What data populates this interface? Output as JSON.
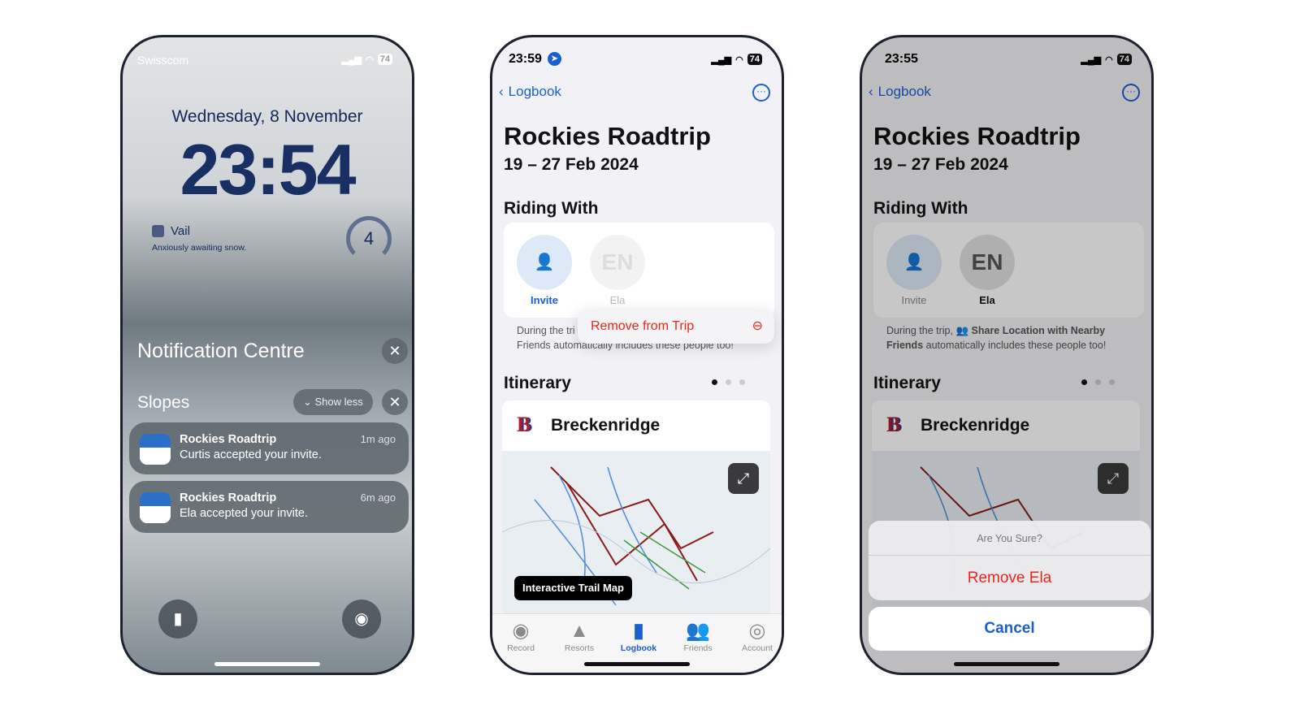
{
  "lock": {
    "carrier": "Swisscom",
    "battery": "74",
    "date": "Wednesday, 8 November",
    "time": "23:54",
    "widget": {
      "title": "Vail",
      "subtitle": "Anxiously awaiting snow.",
      "gauge_value": "4"
    },
    "notification_centre": "Notification Centre",
    "group": "Slopes",
    "show_less": "Show less",
    "notifications": [
      {
        "title": "Rockies Roadtrip",
        "body": "Curtis accepted your invite.",
        "time": "1m ago"
      },
      {
        "title": "Rockies Roadtrip",
        "body": "Ela accepted your invite.",
        "time": "6m ago"
      }
    ]
  },
  "trip1": {
    "status_time": "23:59",
    "battery": "74",
    "back": "Logbook",
    "title": "Rockies Roadtrip",
    "dates": "19 – 27 Feb 2024",
    "riding_with": "Riding With",
    "invite": "Invite",
    "member_initials": "EN",
    "member_name": "Ela",
    "desc_start": "During the tri",
    "desc_end": "Friends automatically includes these people too!",
    "context_menu": "Remove from Trip",
    "itinerary": "Itinerary",
    "resort": "Breckenridge",
    "trail_map": "Interactive Trail Map",
    "tabs": [
      "Record",
      "Resorts",
      "Logbook",
      "Friends",
      "Account"
    ],
    "active_tab": "Logbook"
  },
  "trip2": {
    "status_time": "23:55",
    "battery": "74",
    "back": "Logbook",
    "title": "Rockies Roadtrip",
    "dates": "19 – 27 Feb 2024",
    "riding_with": "Riding With",
    "invite": "Invite",
    "member_initials": "EN",
    "member_name": "Ela",
    "desc_a": "During the trip, ",
    "desc_bold": "Share Location with Nearby Friends",
    "desc_b": " automatically includes these people too!",
    "itinerary": "Itinerary",
    "resort": "Breckenridge",
    "sheet": {
      "title": "Are You Sure?",
      "destructive": "Remove Ela",
      "cancel": "Cancel"
    }
  },
  "colors": {
    "accent": "#1a5fd1",
    "destructive": "#e8261d"
  }
}
